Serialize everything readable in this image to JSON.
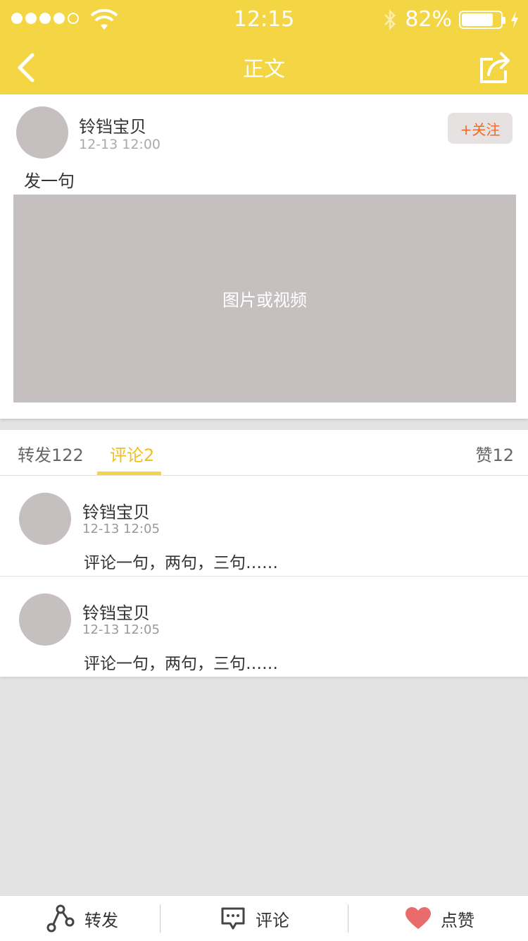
{
  "status_bar": {
    "time": "12:15",
    "battery_percent": "82%",
    "battery_level": 0.82
  },
  "nav": {
    "title": "正文"
  },
  "post": {
    "author": "铃铛宝贝",
    "time": "12-13 12:00",
    "follow_label": "+关注",
    "text": "发一句",
    "media_placeholder": "图片或视频"
  },
  "tabs": {
    "repost": "转发122",
    "comment": "评论2",
    "like": "赞12"
  },
  "comments": [
    {
      "author": "铃铛宝贝",
      "time": "12-13  12:05",
      "text": "评论一句，两句，三句……"
    },
    {
      "author": "铃铛宝贝",
      "time": "12-13  12:05",
      "text": "评论一句，两句，三句……"
    }
  ],
  "bottom_bar": {
    "repost": "转发",
    "comment": "评论",
    "like": "点赞"
  },
  "colors": {
    "accent_yellow": "#f4d543",
    "follow_orange": "#f06a2a",
    "like_red": "#e96b6b",
    "placeholder_gray": "#c6bfbf"
  }
}
